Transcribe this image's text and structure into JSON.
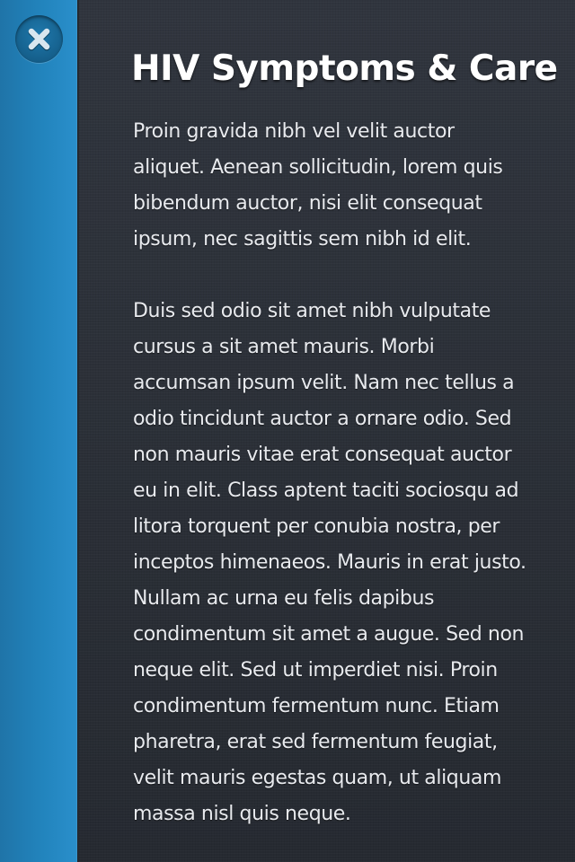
{
  "sidebar": {
    "close_icon": "close-x-icon",
    "accent_color": "#2284bd"
  },
  "article": {
    "title": "HIV Symptoms & Care",
    "paragraphs": [
      "Proin gravida nibh vel velit auctor aliquet. Aenean sollicitudin, lorem quis bibendum auctor, nisi elit consequat ipsum, nec sagittis sem nibh id elit.",
      "Duis sed odio sit amet nibh vulputate cursus a sit amet mauris. Morbi accumsan ipsum velit. Nam nec tellus a odio tincidunt auctor a ornare odio. Sed non  mauris vitae erat consequat auctor eu in elit. Class aptent taciti sociosqu ad litora torquent per conubia nostra, per inceptos himenaeos. Mauris in erat justo. Nullam ac urna eu felis dapibus condimentum sit amet a augue. Sed non neque elit. Sed ut imperdiet nisi. Proin condimentum fermentum nunc. Etiam pharetra, erat sed fermentum feugiat, velit mauris egestas quam, ut aliquam massa nisl quis neque."
    ]
  }
}
